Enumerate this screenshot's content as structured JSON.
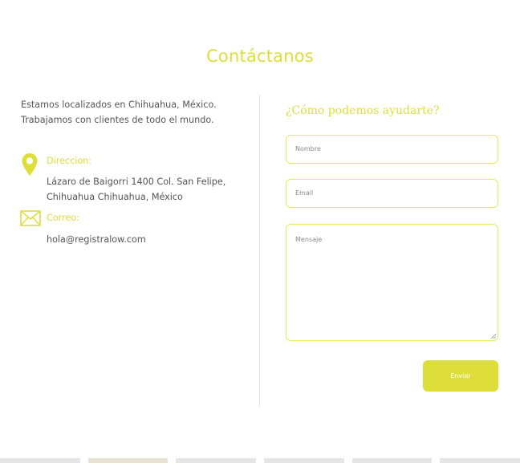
{
  "page": {
    "title": "Contáctanos"
  },
  "intro": {
    "line1": "Estamos localizados en Chihuahua, México.",
    "line2": "Trabajamos con clientes de todo el mundo."
  },
  "contact": {
    "address_label": "Direccion:",
    "address_line1": "Lázaro de Baigorri 1400 Col. San Felipe,",
    "address_line2": "Chihuahua Chihuahua, México",
    "email_label": "Correo:",
    "email_value": "hola@registralow.com",
    "icons": {
      "address": "map-pin-icon",
      "email": "envelope-icon"
    }
  },
  "form": {
    "title": "¿Cómo podemos ayudarte?",
    "name_placeholder": "Nombre",
    "email_placeholder": "Email",
    "message_placeholder": "Mensaje",
    "submit_label": "Enviar"
  },
  "colors": {
    "accent": "#dede3a",
    "field_border": "#e8ea5a",
    "text": "#555555"
  }
}
